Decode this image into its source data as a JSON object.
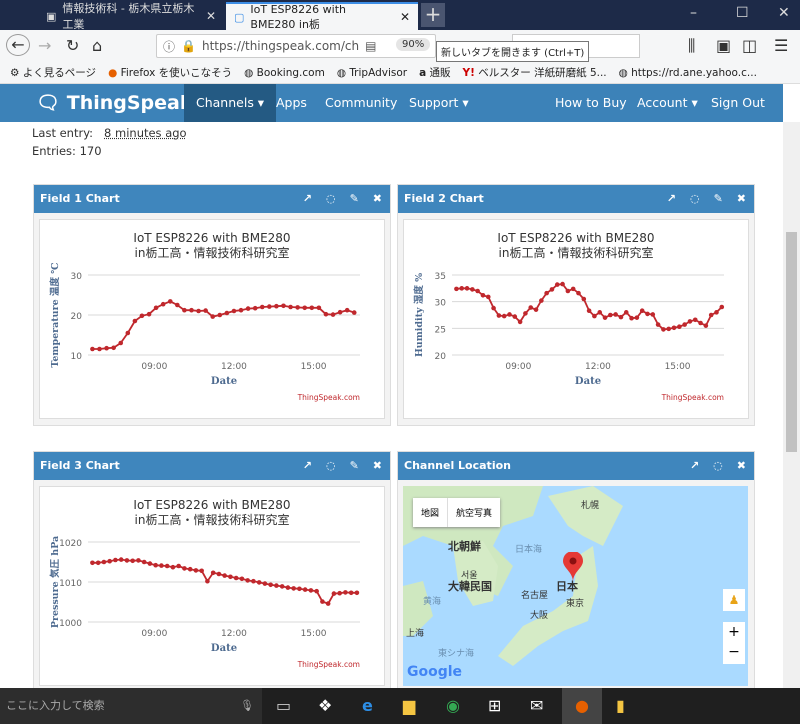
{
  "browser": {
    "tabs": [
      {
        "label": "情報技術科 - 栃木県立栃木工業",
        "active": false
      },
      {
        "label": "IoT ESP8226 with BME280 in栃",
        "active": true
      }
    ],
    "url": "https://thingspeak.com/ch",
    "zoom": "90%",
    "tooltip": "新しいタブを開きます (Ctrl+T)",
    "search_placeholder": "検索",
    "bookmarks": [
      "よく見るページ",
      "Firefox を使いこなそう",
      "Booking.com",
      "TripAdvisor",
      "通販",
      "ベルスター 洋紙研磨紙 5...",
      "https://rd.ane.yahoo.c..."
    ]
  },
  "nav": {
    "logo": "ThingSpeak",
    "tm": "™",
    "items": [
      "Channels ▾",
      "Apps",
      "Community",
      "Support ▾"
    ],
    "right": [
      "How to Buy",
      "Account ▾",
      "Sign Out"
    ]
  },
  "channel": {
    "last_entry_label": "Last entry:",
    "last_entry": "8 minutes ago",
    "entries": "Entries: 170"
  },
  "panels": [
    {
      "title": "Field 1 Chart"
    },
    {
      "title": "Field 2 Chart"
    },
    {
      "title": "Field 3 Chart"
    },
    {
      "title": "Channel Location"
    }
  ],
  "map": {
    "buttons": [
      "地図",
      "航空写真"
    ],
    "labels": [
      "札幌",
      "北朝鮮",
      "日本海",
      "서울",
      "大韓民国",
      "日本",
      "名古屋",
      "東京",
      "大阪",
      "黄海",
      "上海",
      "東シナ海"
    ],
    "logo": "Google"
  },
  "taskbar": {
    "search": "ここに入力して検索"
  },
  "chart_data": [
    {
      "type": "line",
      "title": "IoT ESP8226 with BME280",
      "subtitle": "in栃工高・情報技術科研究室",
      "xlabel": "Date",
      "ylabel": "Temperature 温度 ℃",
      "credit": "ThingSpeak.com",
      "ylim": [
        10,
        30
      ],
      "yticks": [
        10,
        20,
        30
      ],
      "xticks": [
        "09:00",
        "12:00",
        "15:00"
      ],
      "xlim": [
        "06:30",
        "16:45"
      ],
      "color": "#c0282d",
      "grid": true,
      "x": [
        "06:40",
        "06:56",
        "07:12",
        "07:28",
        "07:44",
        "08:00",
        "08:16",
        "08:32",
        "08:48",
        "09:04",
        "09:20",
        "09:36",
        "09:52",
        "10:08",
        "10:24",
        "10:40",
        "10:56",
        "11:12",
        "11:28",
        "11:44",
        "12:00",
        "12:16",
        "12:32",
        "12:48",
        "13:04",
        "13:20",
        "13:36",
        "13:52",
        "14:08",
        "14:24",
        "14:40",
        "14:56",
        "15:12",
        "15:28",
        "15:44",
        "16:00",
        "16:16",
        "16:32"
      ],
      "y": [
        11.5,
        11.5,
        11.7,
        11.8,
        13,
        15.5,
        18.5,
        19.8,
        20.2,
        21.8,
        22.7,
        23.4,
        22.5,
        21.2,
        21.2,
        21,
        21.1,
        19.6,
        20,
        20.5,
        21,
        21.2,
        21.6,
        21.7,
        22,
        22.1,
        22.2,
        22.3,
        22,
        21.9,
        21.8,
        21.8,
        21.8,
        20.2,
        20.1,
        20.7,
        21.2,
        20.6
      ]
    },
    {
      "type": "line",
      "title": "IoT ESP8226 with BME280",
      "subtitle": "in栃工高・情報技術科研究室",
      "xlabel": "Date",
      "ylabel": "Humidity 湿度 %",
      "credit": "ThingSpeak.com",
      "ylim": [
        20,
        35
      ],
      "yticks": [
        20,
        25,
        30,
        35
      ],
      "xticks": [
        "09:00",
        "12:00",
        "15:00"
      ],
      "xlim": [
        "06:30",
        "16:45"
      ],
      "color": "#c0282d",
      "grid": true,
      "x": [
        "06:40",
        "06:52",
        "07:04",
        "07:16",
        "07:28",
        "07:40",
        "07:52",
        "08:04",
        "08:16",
        "08:28",
        "08:40",
        "08:52",
        "09:04",
        "09:16",
        "09:28",
        "09:40",
        "09:52",
        "10:04",
        "10:16",
        "10:28",
        "10:40",
        "10:52",
        "11:04",
        "11:16",
        "11:28",
        "11:40",
        "11:52",
        "12:04",
        "12:16",
        "12:28",
        "12:40",
        "12:52",
        "13:04",
        "13:16",
        "13:28",
        "13:40",
        "13:52",
        "14:04",
        "14:16",
        "14:28",
        "14:40",
        "14:52",
        "15:04",
        "15:16",
        "15:28",
        "15:40",
        "15:52",
        "16:04",
        "16:16",
        "16:28",
        "16:40"
      ],
      "y": [
        32.4,
        32.5,
        32.5,
        32.3,
        32.0,
        31.2,
        30.9,
        28.8,
        27.4,
        27.3,
        27.6,
        27.2,
        26.2,
        27.8,
        28.9,
        28.5,
        30.2,
        31.6,
        32.3,
        33.2,
        33.3,
        32.0,
        32.4,
        31.6,
        30.5,
        28.3,
        27.3,
        28.0,
        27.0,
        27.5,
        27.6,
        27.1,
        28.0,
        26.9,
        27.0,
        28.3,
        27.7,
        27.6,
        25.7,
        24.8,
        24.9,
        25.1,
        25.3,
        25.7,
        26.3,
        26.6,
        26.0,
        25.5,
        27.5,
        28.0,
        29.0
      ]
    },
    {
      "type": "line",
      "title": "IoT ESP8226 with BME280",
      "subtitle": "in栃工高・情報技術科研究室",
      "xlabel": "Date",
      "ylabel": "Pressure 気圧 hPa",
      "credit": "ThingSpeak.com",
      "ylim": [
        1000,
        1020
      ],
      "yticks": [
        1000,
        1010,
        1020
      ],
      "xticks": [
        "09:00",
        "12:00",
        "15:00"
      ],
      "xlim": [
        "06:30",
        "16:45"
      ],
      "color": "#c0282d",
      "grid": true,
      "x": [
        "06:40",
        "06:53",
        "07:06",
        "07:19",
        "07:32",
        "07:45",
        "07:58",
        "08:11",
        "08:24",
        "08:37",
        "08:50",
        "09:03",
        "09:16",
        "09:29",
        "09:42",
        "09:55",
        "10:08",
        "10:21",
        "10:34",
        "10:47",
        "11:00",
        "11:13",
        "11:26",
        "11:39",
        "11:52",
        "12:05",
        "12:18",
        "12:31",
        "12:44",
        "12:57",
        "13:10",
        "13:23",
        "13:36",
        "13:49",
        "14:02",
        "14:15",
        "14:28",
        "14:41",
        "14:54",
        "15:07",
        "15:20",
        "15:33",
        "15:46",
        "15:59",
        "16:12",
        "16:25",
        "16:38"
      ],
      "y": [
        1014.8,
        1014.8,
        1015,
        1015.2,
        1015.5,
        1015.6,
        1015.4,
        1015.3,
        1015.4,
        1015,
        1014.6,
        1014.2,
        1014.1,
        1014,
        1013.7,
        1014,
        1013.4,
        1013.2,
        1012.9,
        1012.8,
        1010.2,
        1012.3,
        1012,
        1011.6,
        1011.3,
        1011,
        1010.8,
        1010.4,
        1010.2,
        1009.9,
        1009.6,
        1009.3,
        1009.1,
        1008.9,
        1008.6,
        1008.4,
        1008.3,
        1008.1,
        1007.9,
        1007.7,
        1005.1,
        1004.6,
        1007.1,
        1007.2,
        1007.4,
        1007.3,
        1007.3
      ]
    }
  ]
}
